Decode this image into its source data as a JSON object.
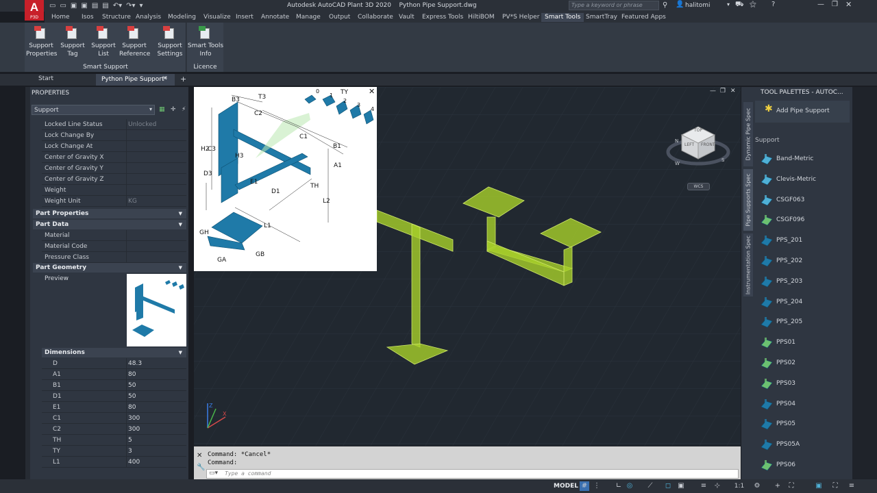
{
  "app": {
    "title": "Autodesk AutoCAD Plant 3D 2020",
    "file": "Python Pipe Support.dwg",
    "logo_text": "A",
    "logo_sub": "P3D",
    "search_placeholder": "Type a keyword or phrase",
    "user": "halitomi"
  },
  "ribbon_tabs": [
    "Home",
    "Isos",
    "Structure",
    "Analysis",
    "Modeling",
    "Visualize",
    "Insert",
    "Annotate",
    "Manage",
    "Output",
    "Collaborate",
    "Vault",
    "Express Tools",
    "HiltiBOM",
    "PV*S Helper",
    "Smart Tools",
    "SmartTray",
    "Featured Apps"
  ],
  "ribbon_active": "Smart Tools",
  "ribbon": {
    "buttons": [
      {
        "line1": "Support",
        "line2": "Properties",
        "icon": "support-properties-icon"
      },
      {
        "line1": "Support",
        "line2": "Tag",
        "icon": "support-tag-icon"
      },
      {
        "line1": "Support",
        "line2": "List",
        "icon": "support-list-icon"
      },
      {
        "line1": "Support",
        "line2": "Reference",
        "icon": "support-reference-icon"
      },
      {
        "line1": "Support",
        "line2": "Settings",
        "icon": "support-settings-icon"
      },
      {
        "line1": "Smart Tools",
        "line2": "Info",
        "icon": "smart-tools-info-icon"
      }
    ],
    "group1": "Smart Support",
    "group2": "Licence"
  },
  "doc_tabs": {
    "start": "Start",
    "active": "Python Pipe Support*",
    "close": "✕",
    "add": "+"
  },
  "properties": {
    "title": "PROPERTIES",
    "selector": "Support",
    "rows_top": [
      {
        "k": "Locked Line Status",
        "v": "Unlocked",
        "dim": true
      },
      {
        "k": "Lock Change By",
        "v": ""
      },
      {
        "k": "Lock Change At",
        "v": ""
      },
      {
        "k": "Center of Gravity X",
        "v": ""
      },
      {
        "k": "Center of Gravity Y",
        "v": ""
      },
      {
        "k": "Center of Gravity Z",
        "v": ""
      },
      {
        "k": "Weight",
        "v": ""
      },
      {
        "k": "Weight Unit",
        "v": "KG",
        "dim": true
      }
    ],
    "sections": {
      "part_properties": "Part Properties",
      "part_data": "Part Data",
      "part_geometry": "Part Geometry",
      "dimensions": "Dimensions"
    },
    "part_data_rows": [
      {
        "k": "Material",
        "v": ""
      },
      {
        "k": "Material Code",
        "v": ""
      },
      {
        "k": "Pressure Class",
        "v": ""
      }
    ],
    "preview_label": "Preview",
    "dimensions": [
      {
        "k": "D",
        "v": "48.3"
      },
      {
        "k": "A1",
        "v": "80"
      },
      {
        "k": "B1",
        "v": "50"
      },
      {
        "k": "D1",
        "v": "50"
      },
      {
        "k": "E1",
        "v": "80"
      },
      {
        "k": "C1",
        "v": "300"
      },
      {
        "k": "C2",
        "v": "300"
      },
      {
        "k": "TH",
        "v": "5"
      },
      {
        "k": "TY",
        "v": "3"
      },
      {
        "k": "L1",
        "v": "400"
      }
    ]
  },
  "drawing_labels": {
    "T3": "T3",
    "B3": "B3",
    "C2": "C2",
    "C1": "C1",
    "B1": "B1",
    "A1": "A1",
    "H2": "H2",
    "C3": "C3",
    "H3": "H3",
    "D3": "D3",
    "E1": "E1",
    "D1": "D1",
    "TH": "TH",
    "L2": "L2",
    "L1": "L1",
    "GH": "GH",
    "GA": "GA",
    "GB": "GB",
    "TY": "TY",
    "ty_nums": [
      "0",
      "1",
      "2",
      "3",
      "4"
    ]
  },
  "viewcube": {
    "top": "TOP",
    "left": "LEFT",
    "front": "FRONT",
    "n": "N",
    "s": "S",
    "w": "W",
    "wcs": "WCS"
  },
  "command": {
    "line1": "Command: *Cancel*",
    "line2": "Command:",
    "placeholder": "Type a command"
  },
  "palette": {
    "title": "TOOL PALETTES - AUTOC...",
    "add": "Add Pipe Support",
    "section": "Support",
    "tabs": [
      "Dynamic Pipe Spec",
      "Pipe Supports Spec",
      "Instrumentation Spec"
    ],
    "items": [
      "Band-Metric",
      "Clevis-Metric",
      "CSGF063",
      "CSGF096",
      "PPS_201",
      "PPS_202",
      "PPS_203",
      "PPS_204",
      "PPS_205",
      "PPS01",
      "PPS02",
      "PPS03",
      "PPS04",
      "PPS05",
      "PPS05A",
      "PPS06"
    ]
  },
  "status": {
    "model": "MODEL",
    "scale": "1:1"
  },
  "colors": {
    "accent": "#4fb0d6",
    "support_green": "#a8cf2a",
    "part_blue": "#1f7aa8",
    "logo_red": "#c8202a"
  }
}
